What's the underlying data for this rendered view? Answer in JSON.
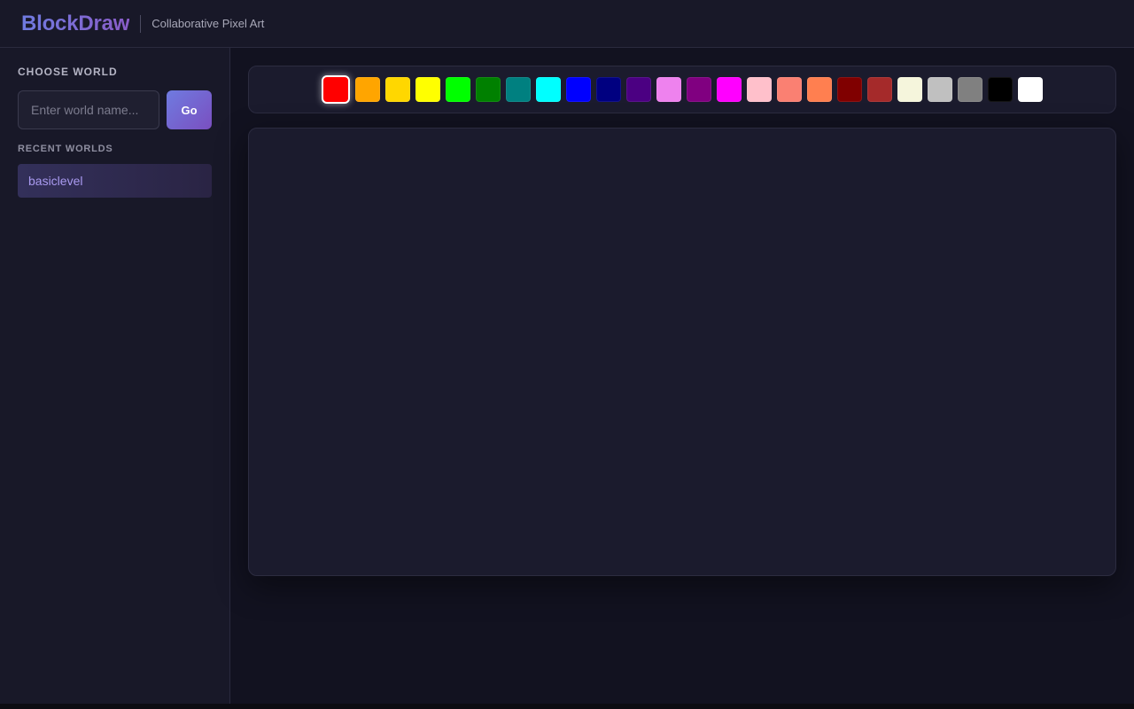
{
  "header": {
    "brand": "BlockDraw",
    "tagline": "Collaborative Pixel Art"
  },
  "sidebar": {
    "choose_world_title": "CHOOSE WORLD",
    "world_input": {
      "value": "",
      "placeholder": "Enter world name..."
    },
    "go_label": "Go",
    "recent_title": "RECENT WORLDS",
    "recent_worlds": [
      "basiclevel"
    ]
  },
  "palette": {
    "selected": "#ff0000",
    "colors": [
      "#ff0000",
      "#ffa500",
      "#ffd700",
      "#ffff00",
      "#00ff00",
      "#008000",
      "#008080",
      "#00ffff",
      "#0000ff",
      "#000080",
      "#4b0082",
      "#ee82ee",
      "#800080",
      "#ff00ff",
      "#ffc0cb",
      "#fa8072",
      "#ff7f50",
      "#800000",
      "#a52a2a",
      "#f5f5dc",
      "#c0c0c0",
      "#808080",
      "#000000",
      "#ffffff"
    ]
  },
  "theme": {
    "accent": "#6f7be0",
    "accent_secondary": "#7a4fc0",
    "background": "#121220",
    "panel": "#181828"
  }
}
